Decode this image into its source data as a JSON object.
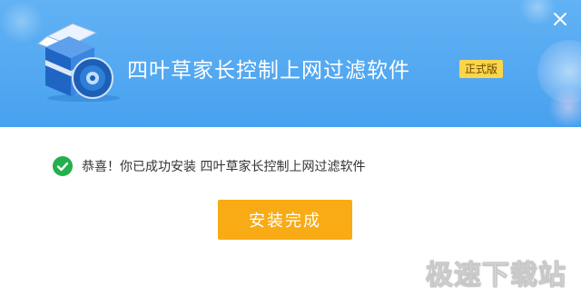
{
  "header": {
    "app_title": "四叶草家长控制上网过滤软件",
    "edition_badge": "正式版"
  },
  "controls": {
    "close_icon": "close-icon"
  },
  "main": {
    "success_icon": "check-circle-icon",
    "success_message": "恭喜！你已成功安装 四叶草家长控制上网过滤软件",
    "finish_button": "安装完成"
  },
  "watermark": "极速下载站",
  "colors": {
    "banner": "#4fa8f1",
    "accent_button": "#f8ab15",
    "badge": "#fcd54a",
    "success": "#22b04a"
  }
}
